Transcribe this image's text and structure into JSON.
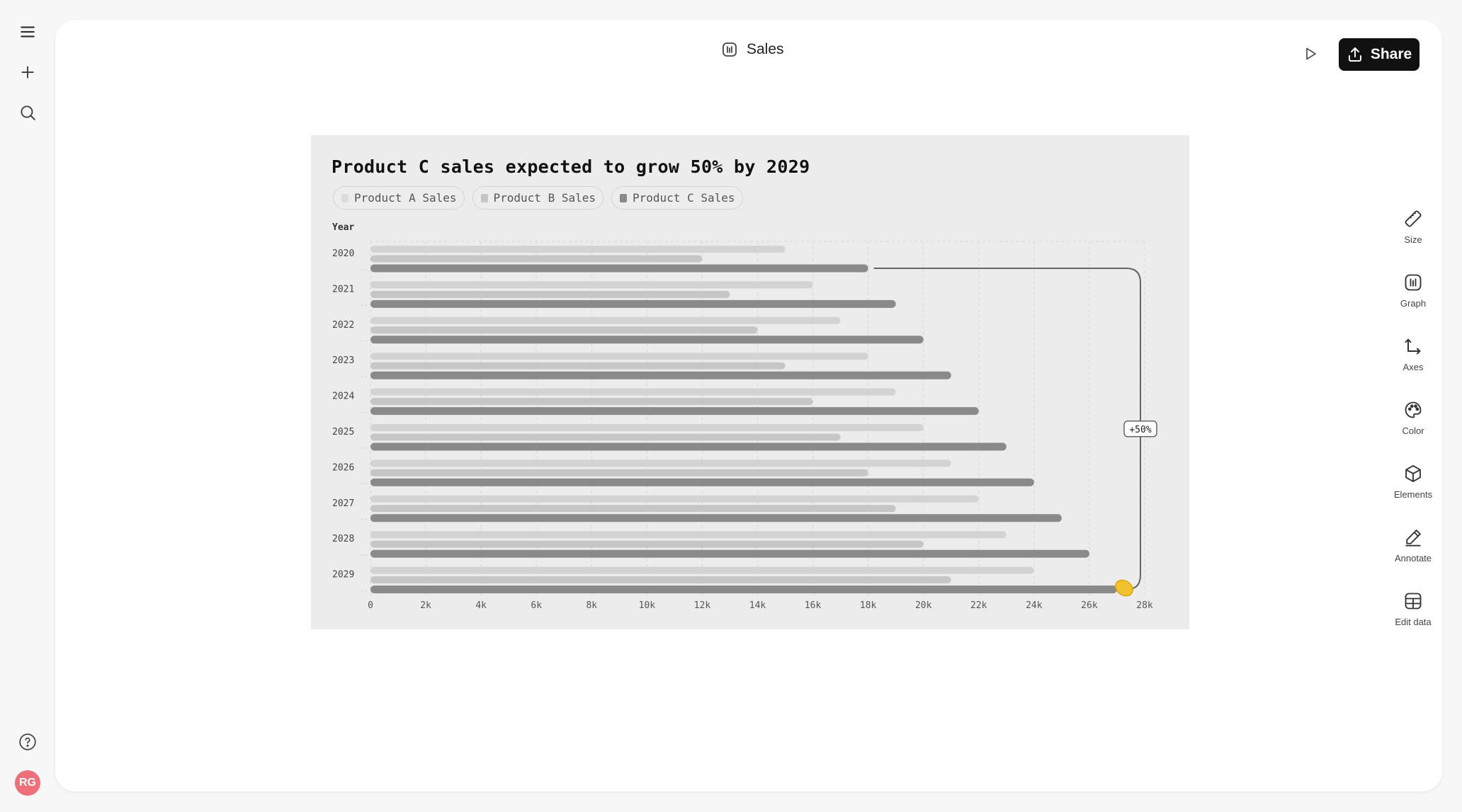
{
  "header": {
    "title": "Sales",
    "share_label": "Share"
  },
  "user": {
    "initials": "RG",
    "avatar_color": "#f0707a"
  },
  "tools": [
    {
      "label": "Size",
      "icon": "ruler-icon"
    },
    {
      "label": "Graph",
      "icon": "bar-chart-icon"
    },
    {
      "label": "Axes",
      "icon": "axes-icon"
    },
    {
      "label": "Color",
      "icon": "palette-icon"
    },
    {
      "label": "Elements",
      "icon": "cube-icon"
    },
    {
      "label": "Annotate",
      "icon": "pen-icon"
    },
    {
      "label": "Edit data",
      "icon": "table-icon"
    }
  ],
  "colors": {
    "series_a": "#d3d3d3",
    "series_b": "#c6c6c6",
    "series_c": "#8a8a8a",
    "chart_bg": "#ececec",
    "share_bg": "#111111"
  },
  "chart_data": {
    "type": "bar",
    "orientation": "horizontal",
    "title": "Product C sales expected to grow 50% by 2029",
    "ylabel": "Year",
    "xlabel": "",
    "categories": [
      "2020",
      "2021",
      "2022",
      "2023",
      "2024",
      "2025",
      "2026",
      "2027",
      "2028",
      "2029"
    ],
    "series": [
      {
        "name": "Product A Sales",
        "values": [
          15000,
          16000,
          17000,
          18000,
          19000,
          20000,
          21000,
          22000,
          23000,
          24000
        ]
      },
      {
        "name": "Product B Sales",
        "values": [
          12000,
          13000,
          14000,
          15000,
          16000,
          17000,
          18000,
          19000,
          20000,
          21000
        ]
      },
      {
        "name": "Product C Sales",
        "values": [
          18000,
          19000,
          20000,
          21000,
          22000,
          23000,
          24000,
          25000,
          26000,
          27000
        ]
      }
    ],
    "xlim": [
      0,
      28000
    ],
    "xticks": [
      0,
      2000,
      4000,
      6000,
      8000,
      10000,
      12000,
      14000,
      16000,
      18000,
      20000,
      22000,
      24000,
      26000,
      28000
    ],
    "xtick_labels": [
      "0",
      "2k",
      "4k",
      "6k",
      "8k",
      "10k",
      "12k",
      "14k",
      "16k",
      "18k",
      "20k",
      "22k",
      "24k",
      "26k",
      "28k"
    ],
    "grid": true,
    "legend": "top-left",
    "annotation": {
      "text": "+50%",
      "series": "Product C Sales",
      "from": "2020",
      "to": "2029"
    }
  }
}
